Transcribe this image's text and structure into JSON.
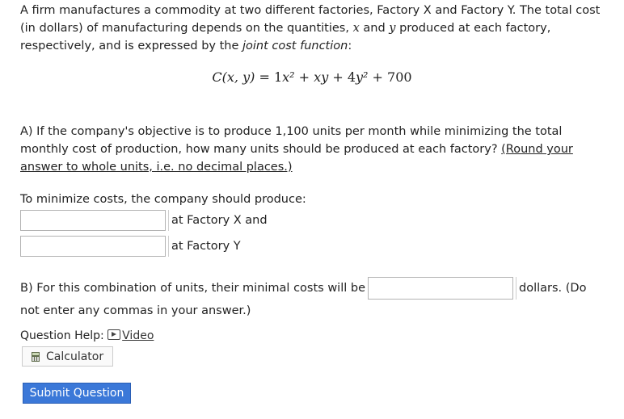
{
  "intro": {
    "line1": "A firm manufactures a commodity at two different factories, Factory X and Factory Y. The total cost",
    "line2_a": "(in dollars) of manufacturing depends on the quantities, ",
    "var_x": "x",
    "line2_b": " and ",
    "var_y": "y",
    "line2_c": " produced at each factory,",
    "line3_a": "respectively, and is expressed by the ",
    "joint_cost_term": "joint cost function",
    "line3_b": ":"
  },
  "formula": {
    "lhs": "C(x, y) = ",
    "c1": "1",
    "t1": "x²",
    "plus1": " + ",
    "t2": "xy",
    "plus2": " + ",
    "c3": "4",
    "t3": "y²",
    "plus3": " + ",
    "c4": "700"
  },
  "partA": {
    "text": "A) If the company's objective is to produce 1,100 units per month while minimizing the total monthly cost of production, how many units should be produced at each factory? ",
    "round_link": "(Round your answer to whole units, i.e. no decimal places.)"
  },
  "minimize_label": "To minimize costs, the company should produce:",
  "answers": {
    "factory_x_value": "",
    "factory_x_label": "at Factory X and",
    "factory_y_value": "",
    "factory_y_label": "at Factory Y"
  },
  "partB": {
    "text": "B) For this combination of units, their minimal costs will be",
    "after": "dollars. (Do",
    "line2": "not enter any commas in your answer.)"
  },
  "help": {
    "label": "Question Help:",
    "video": "Video"
  },
  "calculator_label": "Calculator",
  "submit_label": "Submit Question"
}
